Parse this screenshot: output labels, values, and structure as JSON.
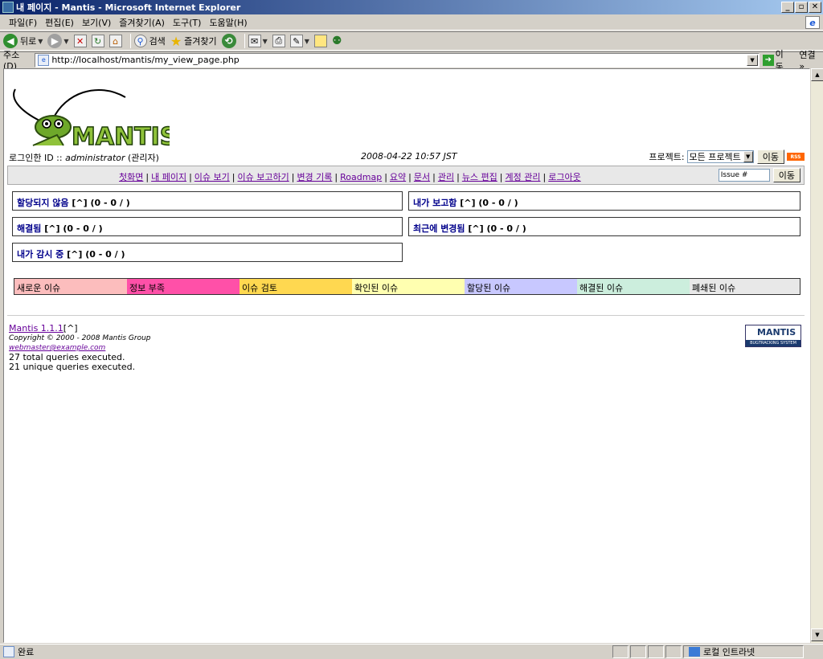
{
  "window": {
    "title": "내 페이지 - Mantis - Microsoft Internet Explorer"
  },
  "menubar": {
    "items": [
      "파일(F)",
      "편집(E)",
      "보기(V)",
      "즐겨찾기(A)",
      "도구(T)",
      "도움말(H)"
    ]
  },
  "toolbar": {
    "back_label": "뒤로",
    "search_label": "검색",
    "favorites_label": "즐겨찾기"
  },
  "address": {
    "label": "주소(D)",
    "url": "http://localhost/mantis/my_view_page.php",
    "go_label": "이동",
    "links_label": "연결 »"
  },
  "header": {
    "logo_text": "MANTIS",
    "login_label": "로그인한 ID ::",
    "username": "administrator",
    "role": "(관리자)",
    "datetime": "2008-04-22 10:57 JST",
    "project_label": "프로젝트:",
    "project_selected": "모든 프로젝트",
    "switch_button": "이동",
    "rss_label": "RSS"
  },
  "main_menu": {
    "links": [
      "첫화면",
      "내 페이지",
      "이슈 보기",
      "이슈 보고하기",
      "변경 기록",
      "Roadmap",
      "요약",
      "문서",
      "관리",
      "뉴스 편집",
      "계정 관리",
      "로그아웃"
    ],
    "jump_placeholder": "Issue #",
    "jump_button": "이동"
  },
  "boxes": {
    "unassigned": {
      "title": "할당되지 않음",
      "link": "[^]",
      "count": "(0 - 0 / )"
    },
    "reported_by_me": {
      "title": "내가 보고함",
      "link": "[^]",
      "count": "(0 - 0 / )"
    },
    "resolved": {
      "title": "해결됨",
      "link": "[^]",
      "count": "(0 - 0 / )"
    },
    "recently_modified": {
      "title": "최근에 변경됨",
      "link": "[^]",
      "count": "(0 - 0 / )"
    },
    "monitored_by_me": {
      "title": "내가 감시 중",
      "link": "[^]",
      "count": "(0 - 0 / )"
    }
  },
  "status_legend": [
    {
      "label": "새로운 이슈",
      "color": "#fcbdbd"
    },
    {
      "label": "정보 부족",
      "color": "#ff50a8"
    },
    {
      "label": "이슈 검토",
      "color": "#ffd850"
    },
    {
      "label": "확인된 이슈",
      "color": "#ffffb0"
    },
    {
      "label": "할당된 이슈",
      "color": "#c8c8ff"
    },
    {
      "label": "해결된 이슈",
      "color": "#cceedd"
    },
    {
      "label": "폐쇄된 이슈",
      "color": "#e8e8e8"
    }
  ],
  "footer": {
    "version": "Mantis 1.1.1",
    "version_link": "[^]",
    "copyright": "Copyright © 2000 - 2008 Mantis Group",
    "email": "webmaster@example.com",
    "total_queries": "27 total queries executed.",
    "unique_queries": "21 unique queries executed.",
    "small_logo_text": "MANTIS",
    "small_logo_sub": "BUGTRACKING SYSTEM"
  },
  "statusbar": {
    "done": "완료",
    "zone": "로컬 인트라넷"
  }
}
